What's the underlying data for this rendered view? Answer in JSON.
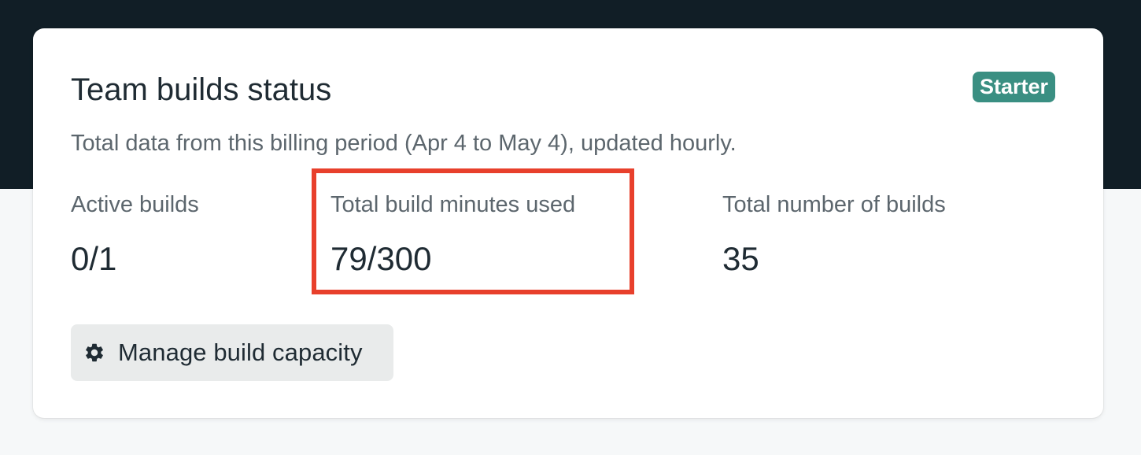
{
  "card": {
    "title": "Team builds status",
    "badge": "Starter",
    "subtitle": "Total data from this billing period (Apr 4 to May 4), updated hourly."
  },
  "stats": [
    {
      "label": "Active builds",
      "value": "0/1"
    },
    {
      "label": "Total build minutes used",
      "value": "79/300"
    },
    {
      "label": "Total number of builds",
      "value": "35"
    }
  ],
  "actions": {
    "manage_label": "Manage build capacity",
    "manage_icon": "gear-icon"
  },
  "colors": {
    "header_background": "#111e26",
    "badge_background": "#3a8f82",
    "highlight_border": "#e8402c"
  }
}
